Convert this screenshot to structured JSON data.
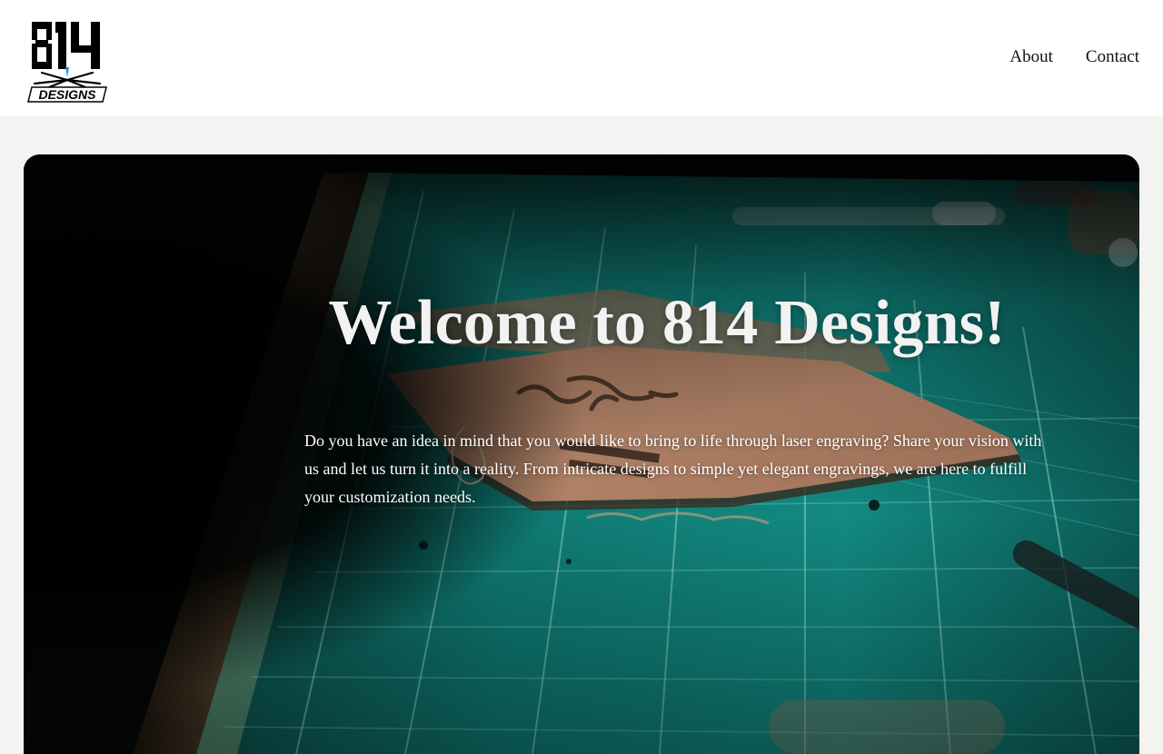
{
  "brand": {
    "logo_top": "814",
    "logo_bottom": "DESIGNS"
  },
  "nav": {
    "about_label": "About",
    "contact_label": "Contact"
  },
  "hero": {
    "title": "Welcome to 814 Designs!",
    "body": "Do you have an idea in mind that you would like to bring to life through laser engraving? Share your vision with us and let us turn it into a reality. From intricate designs to simple yet elegant engravings, we are here to fulfill your customization needs."
  },
  "colors": {
    "header_bg": "#ffffff",
    "page_bg": "#f3f3f1",
    "mat_teal": "#0f7f78",
    "leather": "#b3836a",
    "text_light": "#f2f2f2"
  }
}
